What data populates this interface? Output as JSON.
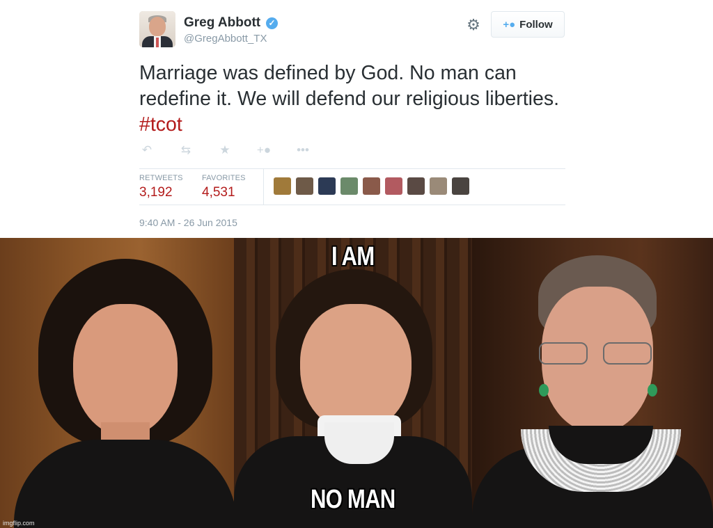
{
  "tweet": {
    "author_name": "Greg Abbott",
    "handle": "@GregAbbott_TX",
    "verified_icon": "✓",
    "follow_label": "Follow",
    "follow_icon": "+👤",
    "text_main": "Marriage was defined by God. No man can redefine it. We will defend our religious liberties. ",
    "hashtag": "#tcot",
    "stats": {
      "retweets_label": "RETWEETS",
      "retweets_value": "3,192",
      "favorites_label": "FAVORITES",
      "favorites_value": "4,531"
    },
    "timestamp": "9:40 AM - 26 Jun 2015",
    "actions": [
      "reply-icon",
      "retweet-icon",
      "favorite-icon",
      "follow-icon",
      "more-icon"
    ],
    "favoriter_avatars": [
      "#a07a3a",
      "#6e5a48",
      "#2c3a55",
      "#6b8a6a",
      "#8a5a4a",
      "#b25a60",
      "#5a4a44",
      "#9a8a78",
      "#4a4440"
    ]
  },
  "meme": {
    "top_caption": "I AM",
    "bottom_caption": "NO MAN",
    "watermark": "imgflip.com"
  },
  "colors": {
    "accent_blue": "#55acee",
    "hashtag_red": "#b31b1b",
    "muted": "#8899a6"
  }
}
